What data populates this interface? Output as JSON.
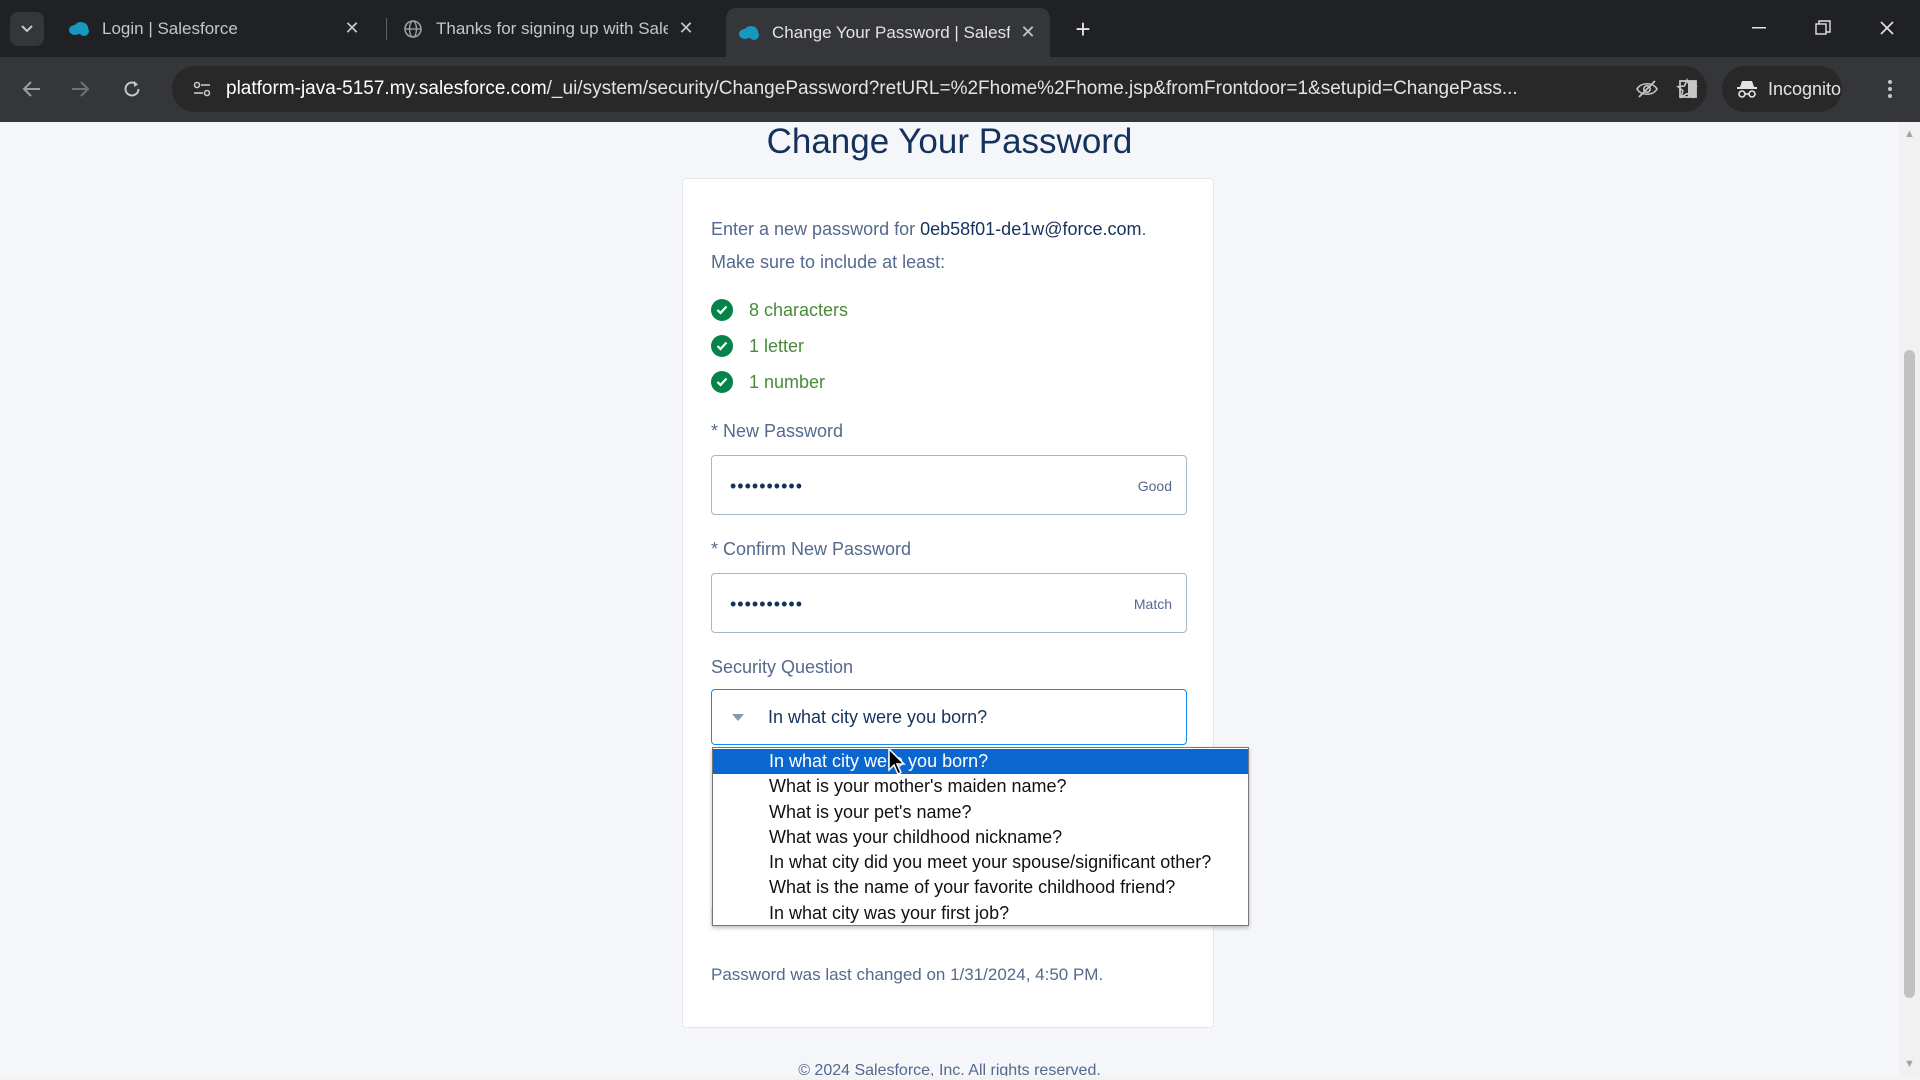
{
  "browser": {
    "tabs": [
      {
        "title": "Login | Salesforce",
        "active": false
      },
      {
        "title": "Thanks for signing up with Sale",
        "active": false
      },
      {
        "title": "Change Your Password | Salesfo",
        "active": true
      }
    ],
    "url_host": "platform-java-5157.my.salesforce.com",
    "url_path": "/_ui/system/security/ChangePassword?retURL=%2Fhome%2Fhome.jsp&fromFrontdoor=1&setupid=ChangePass...",
    "incognito_label": "Incognito"
  },
  "page": {
    "title": "Change Your Password",
    "intro_prefix": "Enter a new password for ",
    "email": "0eb58f01-de1w@force.com",
    "intro_suffix": ".",
    "make_sure": "Make sure to include at least:",
    "requirements": [
      "8 characters",
      "1 letter",
      "1 number"
    ],
    "new_password": {
      "label": "New Password",
      "value": "••••••••••",
      "strength": "Good"
    },
    "confirm_password": {
      "label": "Confirm New Password",
      "value": "••••••••••",
      "status": "Match"
    },
    "security_question": {
      "label": "Security Question",
      "selected": "In what city were you born?",
      "options": [
        "In what city were you born?",
        "What is your mother's maiden name?",
        "What is your pet's name?",
        "What was your childhood nickname?",
        "In what city did you meet your spouse/significant other?",
        "What is the name of your favorite childhood friend?",
        "In what city was your first job?"
      ]
    },
    "last_changed": "Password was last changed on 1/31/2024, 4:50 PM.",
    "footer": "© 2024 Salesforce, Inc. All rights reserved."
  },
  "colors": {
    "title": "#16325c",
    "check_green": "#04844b",
    "select_focus": "#1589ee",
    "option_highlight": "#0b67d0"
  }
}
